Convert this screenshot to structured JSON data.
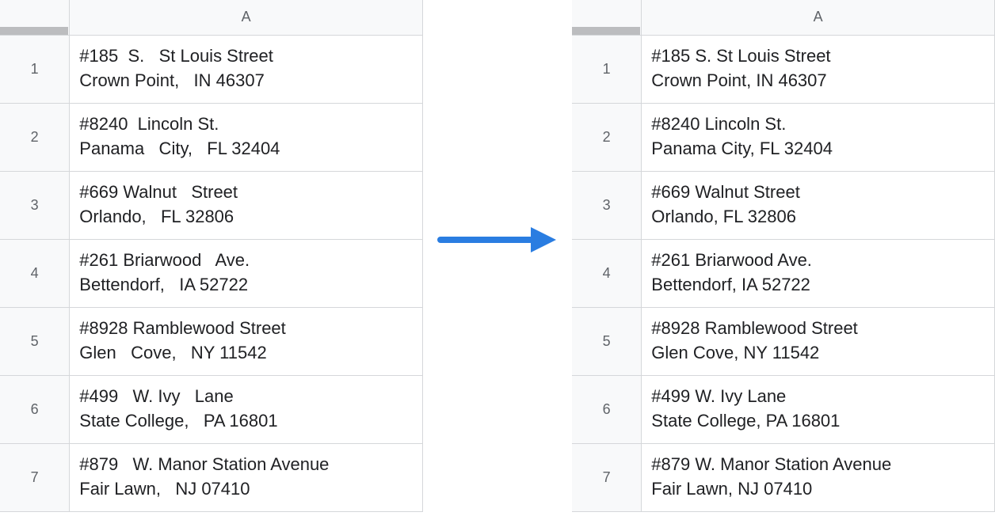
{
  "left_sheet": {
    "column_label": "A",
    "rows": [
      {
        "num": "1",
        "line1": "#185  S.   St Louis Street",
        "line2": "Crown Point,   IN 46307"
      },
      {
        "num": "2",
        "line1": "#8240  Lincoln St.",
        "line2": "Panama   City,   FL 32404"
      },
      {
        "num": "3",
        "line1": "#669 Walnut   Street",
        "line2": "Orlando,   FL 32806"
      },
      {
        "num": "4",
        "line1": "#261 Briarwood   Ave.",
        "line2": "Bettendorf,   IA 52722"
      },
      {
        "num": "5",
        "line1": "#8928 Ramblewood Street",
        "line2": "Glen   Cove,   NY 11542"
      },
      {
        "num": "6",
        "line1": "#499   W. Ivy   Lane",
        "line2": "State College,   PA 16801"
      },
      {
        "num": "7",
        "line1": "#879   W. Manor Station Avenue",
        "line2": "Fair Lawn,   NJ 07410"
      }
    ]
  },
  "right_sheet": {
    "column_label": "A",
    "rows": [
      {
        "num": "1",
        "line1": "#185 S. St Louis Street",
        "line2": "Crown Point, IN 46307"
      },
      {
        "num": "2",
        "line1": "#8240 Lincoln St.",
        "line2": "Panama City, FL 32404"
      },
      {
        "num": "3",
        "line1": "#669 Walnut Street",
        "line2": "Orlando, FL 32806"
      },
      {
        "num": "4",
        "line1": "#261 Briarwood Ave.",
        "line2": "Bettendorf, IA 52722"
      },
      {
        "num": "5",
        "line1": "#8928 Ramblewood Street",
        "line2": "Glen Cove, NY 11542"
      },
      {
        "num": "6",
        "line1": "#499 W. Ivy Lane",
        "line2": "State College, PA 16801"
      },
      {
        "num": "7",
        "line1": "#879 W. Manor Station Avenue",
        "line2": "Fair Lawn, NJ 07410"
      }
    ]
  },
  "arrow_color": "#2a7de1"
}
